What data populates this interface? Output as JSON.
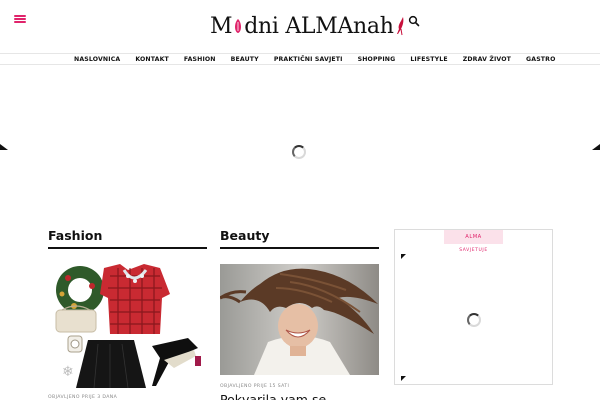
{
  "header": {
    "menu_icon": "hamburger-icon",
    "logo_text_left": "M",
    "logo_text_right": "dni ALMAnah",
    "search_icon": "search-icon"
  },
  "nav": {
    "items": [
      "NASLOVNICA",
      "KONTAKT",
      "FASHION",
      "BEAUTY",
      "PRAKTIČNI SAVJETI",
      "SHOPPING",
      "LIFESTYLE",
      "ZDRAV ŽIVOT",
      "GASTRO"
    ]
  },
  "sections": {
    "fashion": {
      "heading": "Fashion",
      "meta": "OBJAVLJENO PRIJE 3 DANA"
    },
    "beauty": {
      "heading": "Beauty",
      "meta": "OBJAVLJENO PRIJE 15 SATI",
      "post_title": "Pokvarila vam se"
    }
  },
  "widget": {
    "tab_label": "ALMA",
    "subtitle": "SAVJETUJE"
  },
  "colors": {
    "accent": "#e0246b",
    "text": "#111111",
    "rule": "#111111"
  }
}
